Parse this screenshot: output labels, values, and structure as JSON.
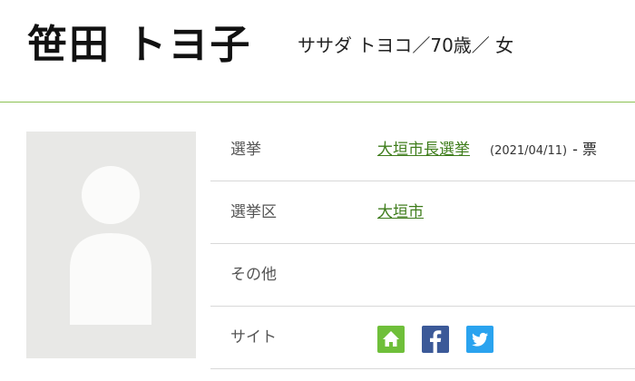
{
  "candidate": {
    "name": "笹田 トヨ子",
    "subinfo": "ササダ トヨコ／70歳／ 女"
  },
  "colors": {
    "accent": "#8cc152",
    "link": "#3f7d1c",
    "home_icon": "#6fbf3a",
    "facebook_icon": "#3b5998",
    "twitter_icon": "#2aa3ef"
  },
  "photo": {
    "icon": "person-placeholder-icon"
  },
  "rows": [
    {
      "label": "選挙",
      "link": "大垣市長選挙",
      "date": "(2021/04/11)",
      "extra": "- 票"
    },
    {
      "label": "選挙区",
      "link": "大垣市"
    },
    {
      "label": "その他"
    },
    {
      "label": "サイト",
      "icons": [
        "home-icon",
        "facebook-icon",
        "twitter-icon"
      ]
    }
  ]
}
